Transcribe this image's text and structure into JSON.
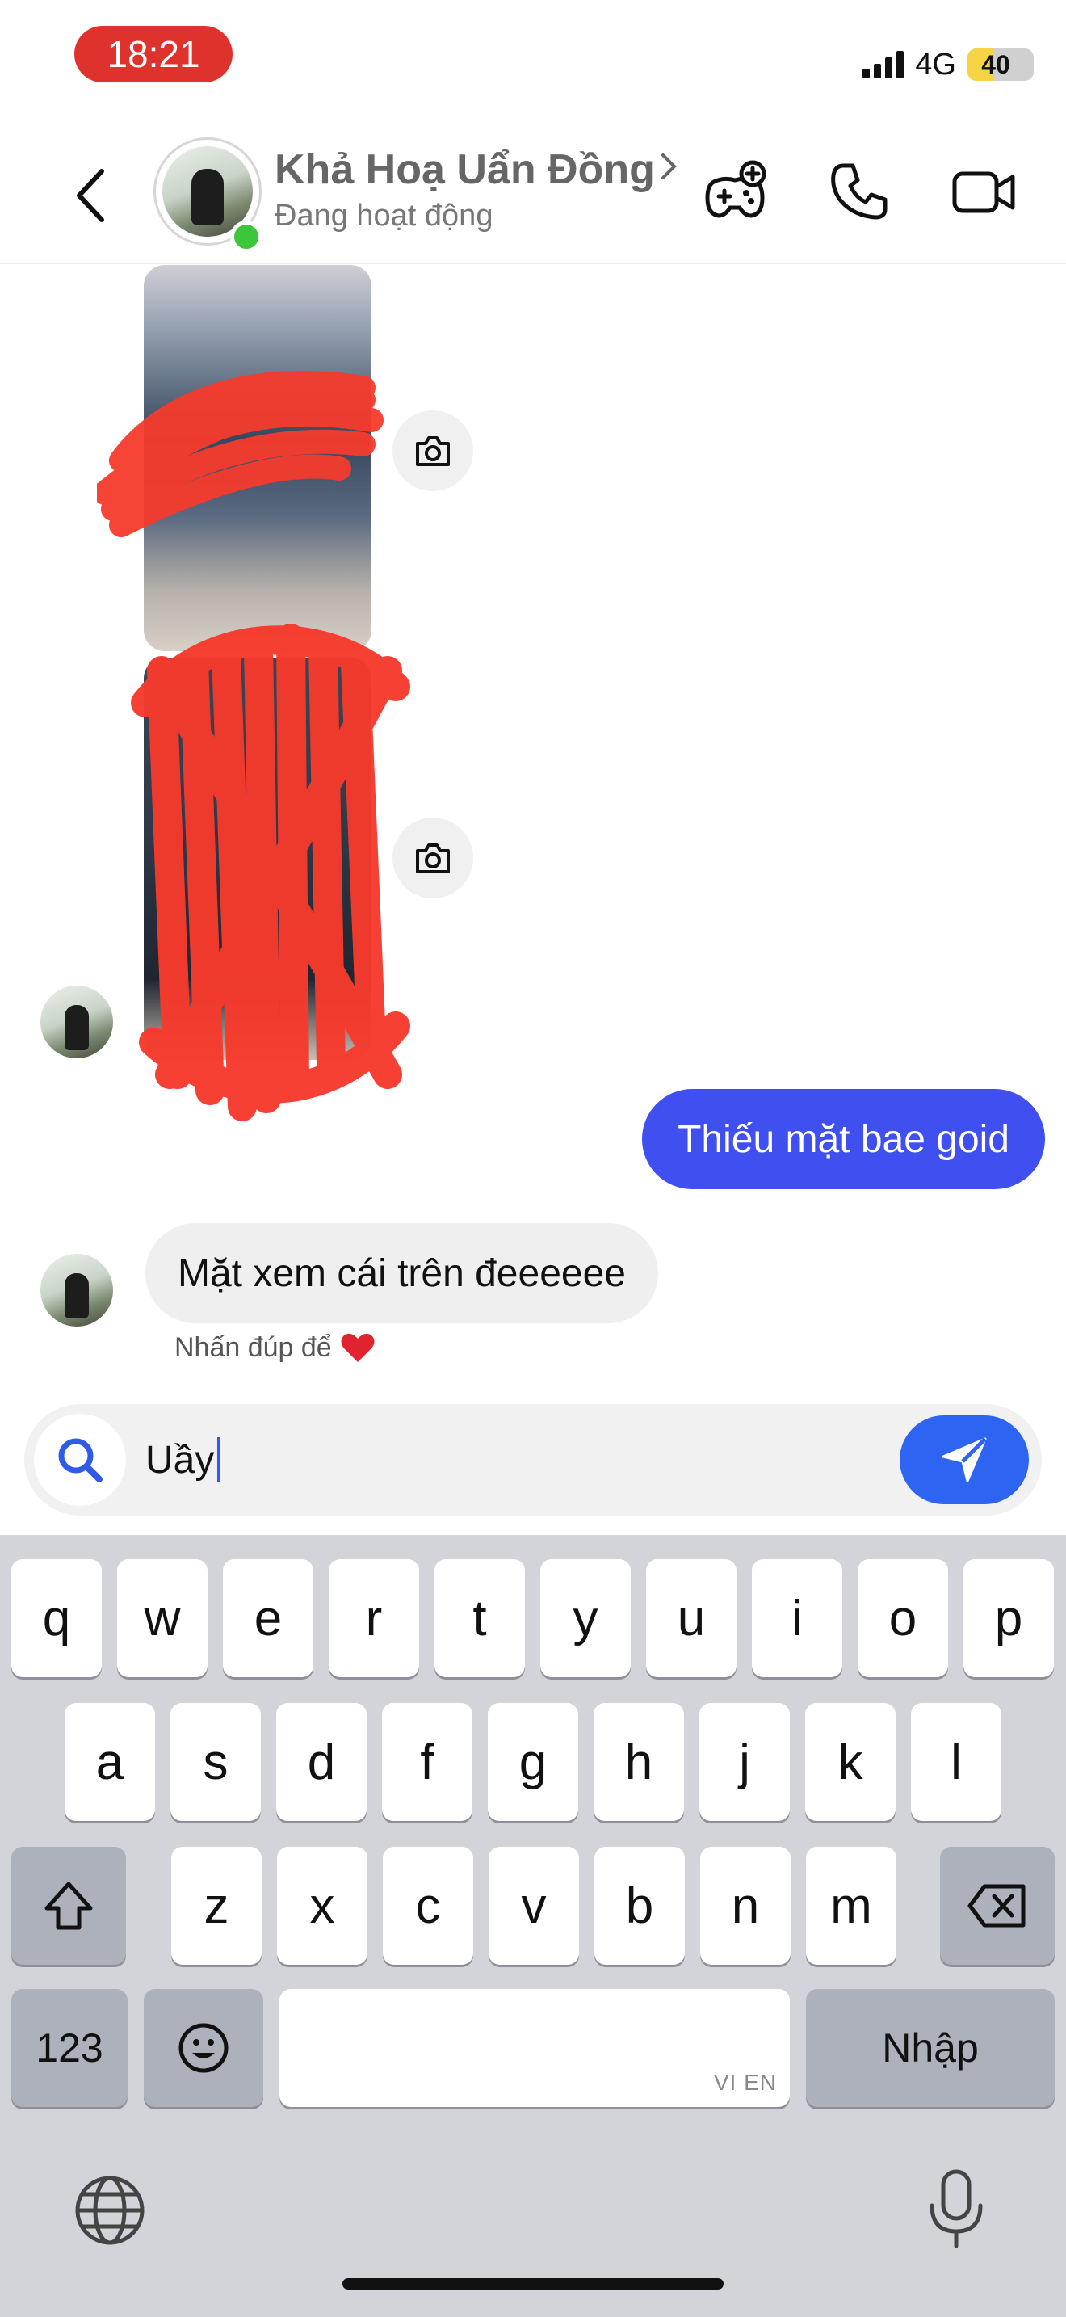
{
  "status_bar": {
    "time": "18:21",
    "network": "4G",
    "battery": "40",
    "battery_level_pct": 40
  },
  "header": {
    "contact_name": "Khả Hoạ Uẩn Đồng",
    "status": "Đang hoạt động",
    "icons": [
      "back-arrow-icon",
      "game-controller-icon",
      "phone-icon",
      "video-camera-icon"
    ]
  },
  "messages": {
    "outgoing": "Thiếu mặt bae goid",
    "incoming": "Mặt xem cái trên đeeeeee",
    "hint": "Nhấn đúp để",
    "hint_emoji": "❤️"
  },
  "composer": {
    "text": "Uầy"
  },
  "keyboard": {
    "row1": [
      "q",
      "w",
      "e",
      "r",
      "t",
      "y",
      "u",
      "i",
      "o",
      "p"
    ],
    "row2": [
      "a",
      "s",
      "d",
      "f",
      "g",
      "h",
      "j",
      "k",
      "l"
    ],
    "row3": [
      "z",
      "x",
      "c",
      "v",
      "b",
      "n",
      "m"
    ],
    "numbers_label": "123",
    "return_label": "Nhập",
    "space_label": "VI EN"
  },
  "colors": {
    "accent": "#3f4ff0",
    "send": "#2d65f2",
    "redaction": "#f53a2c",
    "online": "#3cc63c"
  }
}
